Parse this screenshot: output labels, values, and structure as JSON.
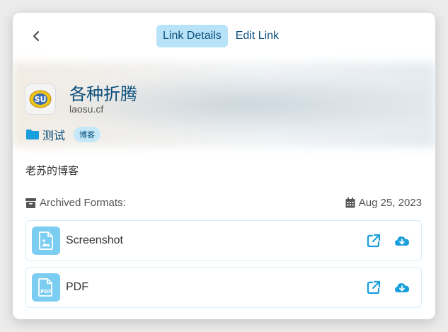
{
  "header": {
    "tabs": [
      {
        "label": "Link Details",
        "active": true
      },
      {
        "label": "Edit Link",
        "active": false
      }
    ]
  },
  "link": {
    "title": "各种折腾",
    "domain": "laosu.cf",
    "favicon_text": "SU",
    "collection": "测试",
    "tags": [
      "博客"
    ],
    "description": "老苏的博客"
  },
  "archive": {
    "label": "Archived Formats:",
    "date": "Aug 25, 2023",
    "formats": [
      {
        "name": "Screenshot",
        "icon": "image-file-icon"
      },
      {
        "name": "PDF",
        "icon": "pdf-file-icon",
        "badge": "PDF"
      }
    ]
  },
  "colors": {
    "accent": "#0b4f7c",
    "icon_blue": "#1a9fdc",
    "tab_active_bg": "#b8e2f7",
    "file_icon_bg": "#7ccdf2"
  }
}
